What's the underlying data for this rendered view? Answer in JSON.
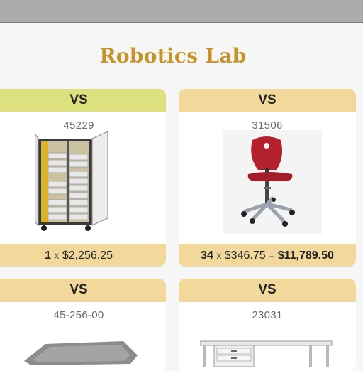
{
  "page": {
    "title": "Robotics Lab"
  },
  "colors": {
    "accent_green": "#dce07f",
    "accent_tan": "#f2d89b",
    "title_gold": "#c4942a"
  },
  "cards": [
    {
      "label": "VS",
      "code": "45229",
      "icon": "storage-cabinet-icon",
      "qty": "1",
      "times": "x",
      "unit_price": "$2,256.25",
      "equals": "",
      "total": ""
    },
    {
      "label": "VS",
      "code": "31506",
      "icon": "red-swivel-chair-icon",
      "qty": "34",
      "times": "x",
      "unit_price": "$346.75",
      "equals": "=",
      "total": "$11,789.50"
    },
    {
      "label": "VS",
      "code": "45-256-00",
      "icon": "gray-tray-icon"
    },
    {
      "label": "VS",
      "code": "23031",
      "icon": "white-desk-icon"
    }
  ]
}
